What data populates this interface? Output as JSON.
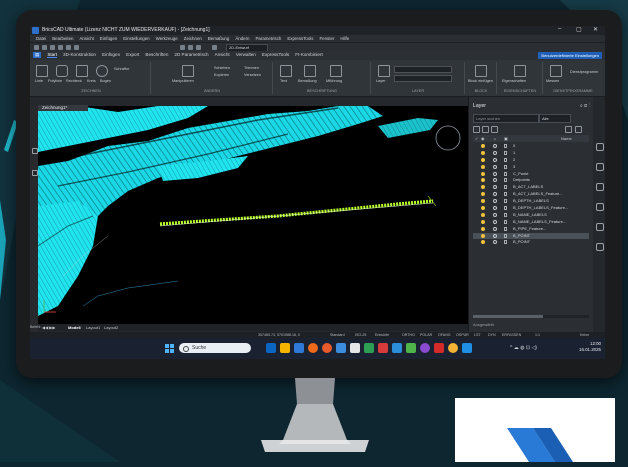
{
  "window": {
    "title": "BricsCAD Ultimate (Lizenz NICHT ZUM WIEDERVERKAUF) - [Zeichnung1]",
    "controls": [
      "–",
      "▢",
      "✕"
    ]
  },
  "menu": [
    "Datei",
    "Bearbeiten",
    "Ansicht",
    "Einfügen",
    "Einstellungen",
    "Werkzeuge",
    "Zeichnen",
    "Bemaßung",
    "Ändern",
    "Parametrisch",
    "ExpressTools",
    "Fenster",
    "Hilfe"
  ],
  "quick_access": {
    "doc_combo": "2D-Entwurf"
  },
  "ribbon_tabs": [
    "Start",
    "3D-Konstruktion",
    "Einfügen",
    "Export",
    "Beschriften",
    "2D Parametrisch",
    "Ansicht",
    "Verwalten",
    "ExpressTools",
    "FI-Kombiniert"
  ],
  "user_badge": "Benutzerdefinierte Einstellungen",
  "ribbon_groups": [
    {
      "label": "ZEICHNEN",
      "tools": [
        "Linie",
        "Polylinie",
        "Rechteck",
        "Kreis",
        "Bogen",
        "Schraffur"
      ]
    },
    {
      "label": "ÄNDERN",
      "tools": [
        "Manipulieren",
        "Schieben",
        "Kopieren",
        "Trimmen",
        "Versetzen"
      ]
    },
    {
      "label": "BESCHRIFTUNG",
      "tools": [
        "Text",
        "Bemaßung",
        "Mführung"
      ]
    },
    {
      "label": "LAYER",
      "tools": [
        "Layer"
      ]
    },
    {
      "label": "BLOCK",
      "tools": [
        "Block einfügen"
      ]
    },
    {
      "label": "EIGENSCHAFTEN",
      "tools": [
        "Eigenschaften"
      ]
    },
    {
      "label": "DIENSTPROGRAMME",
      "tools": [
        "Messen",
        "Dienstprogramm"
      ]
    }
  ],
  "document_tab": "Zeichnung1*",
  "layout_tabs": [
    "Modell",
    "Layout1",
    "Layout2"
  ],
  "command_prompt": "Befehl:",
  "status": {
    "coords": "357465.73, 5701988.16, 0",
    "mode": "Standard",
    "fields": [
      "Standard",
      "ISO-25",
      "Entwürfe",
      "ORTHO",
      "POLAR",
      "OFANG",
      "OSPUR",
      "LST",
      "DYN",
      "ERFASSEN"
    ],
    "scale": "1:1",
    "right": "Keine"
  },
  "layer_panel": {
    "title": "Layer",
    "filter_placeholder": "Layer suchen",
    "filter_value": "Alle",
    "column_name": "Name",
    "layers": [
      {
        "name": "0"
      },
      {
        "name": "1"
      },
      {
        "name": "2"
      },
      {
        "name": "3"
      },
      {
        "name": "C_Punkt"
      },
      {
        "name": "Defpoints"
      },
      {
        "name": "B_ACT_LABELS"
      },
      {
        "name": "B_ACT_LABELS_Feature..."
      },
      {
        "name": "B_DEPTH_LABELS"
      },
      {
        "name": "B_DEPTH_LABELS_Feature..."
      },
      {
        "name": "B_NAME_LABELS"
      },
      {
        "name": "B_NAME_LABELS_Feature..."
      },
      {
        "name": "B_PIPE_Feature..."
      },
      {
        "name": "B_POINT"
      },
      {
        "name": "B_POINT"
      }
    ],
    "selected_index": 13,
    "footer": "Ausgewählt"
  },
  "taskbar": {
    "search_placeholder": "Suche",
    "time": "12:00",
    "date": "16.01.2025",
    "tray": "^  ☁  ◍  ⊡ ◁)"
  },
  "colors": {
    "hatch": "#21e4ef",
    "profile_line": "#b8ff26",
    "accent": "#3d8bff",
    "desk_bg": "#0d2630"
  }
}
